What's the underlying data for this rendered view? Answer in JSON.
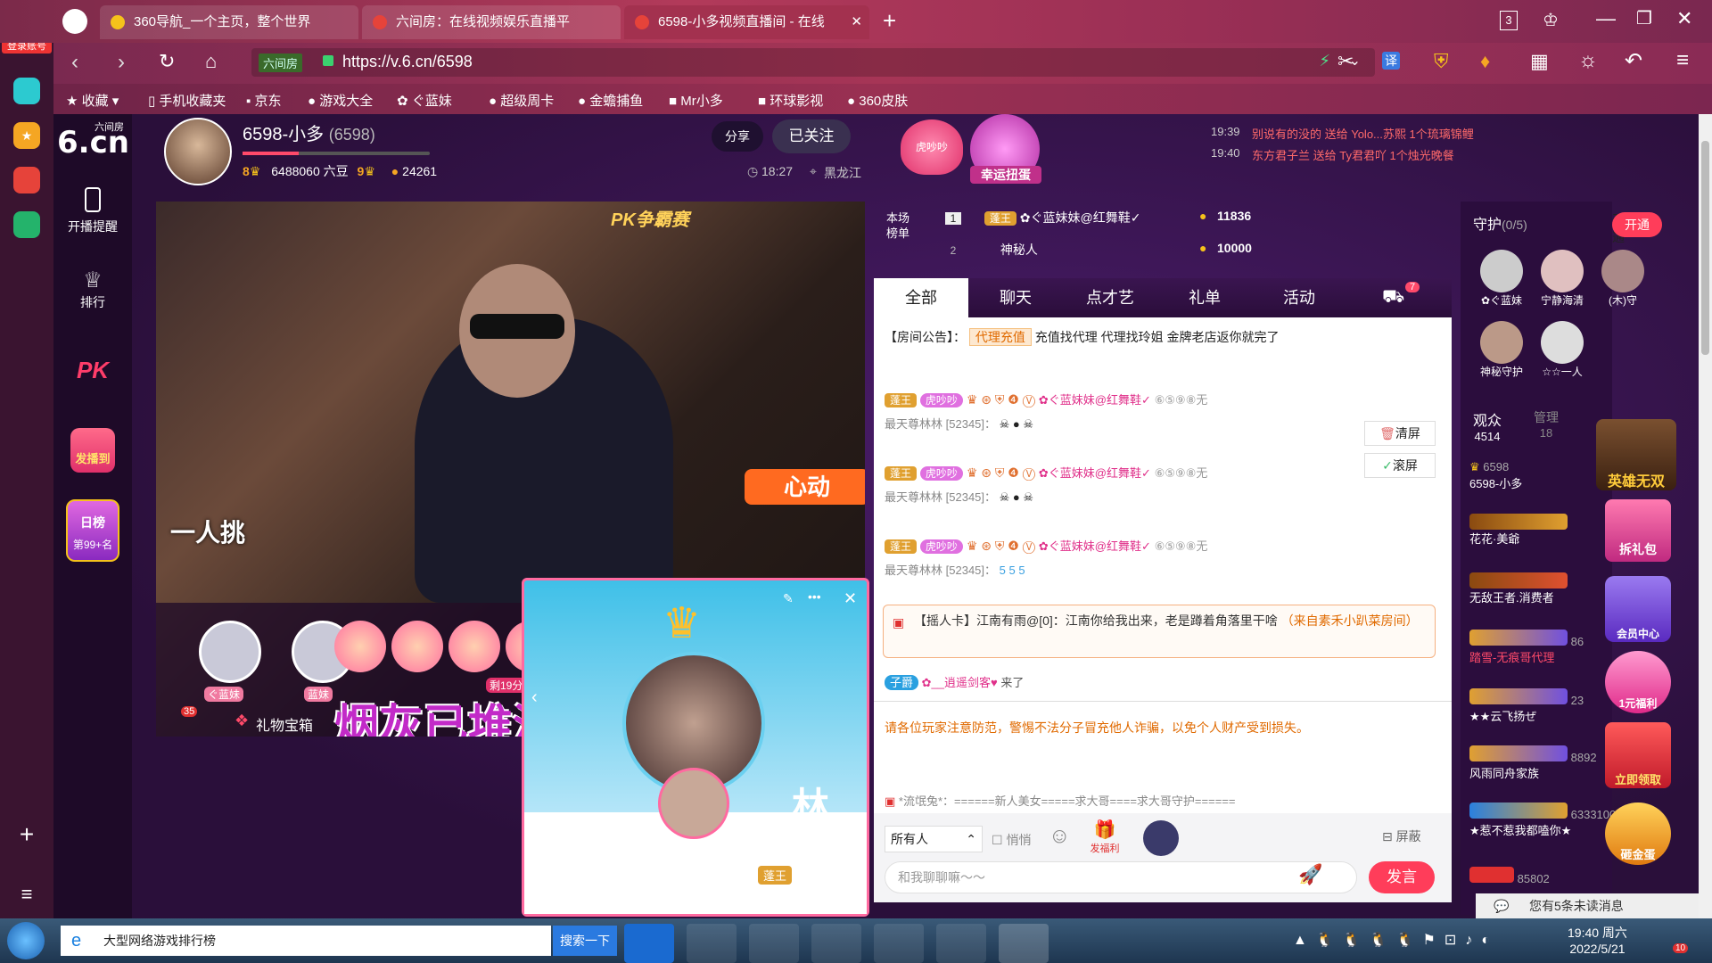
{
  "browser": {
    "left_login": "登录账号",
    "tabs": [
      {
        "title": "360导航_一个主页，整个世界"
      },
      {
        "title": "六间房：在线视频娱乐直播平"
      },
      {
        "title": "6598-小多视频直播间 - 在线"
      }
    ],
    "tab_count": "3",
    "url": "https://v.6.cn/6598",
    "url_label": "六间房",
    "bookmarks": [
      "收藏",
      "手机收藏夹",
      "京东",
      "游戏大全",
      "ぐ蓝妹",
      "超级周卡",
      "金蟾捕鱼",
      "Mr小多",
      "环球影视",
      "360皮肤"
    ]
  },
  "site": {
    "logo": "6.cn",
    "logo_sub": "六间房",
    "nav": [
      {
        "label": "开播提醒"
      },
      {
        "label": "排行"
      },
      {
        "label": "PK"
      },
      {
        "label": "发播到"
      }
    ],
    "daily": {
      "title": "日榜",
      "rank": "第99+名"
    },
    "host": {
      "name": "6598-小多",
      "id": "(6598)",
      "level_left": "8",
      "beans": "6488060 六豆",
      "level_right": "9",
      "fans": "24261",
      "time": "18:27",
      "location": "黑龙江"
    },
    "buttons": {
      "share": "分享",
      "followed": "已关注"
    },
    "badges": {
      "left": "虎吵吵",
      "lucky": "幸运扭蛋"
    },
    "ticker": [
      {
        "time": "19:39",
        "text": "别说有的没的 送给 Yolo...苏熙 1个琉璃锦鲤"
      },
      {
        "time": "19:40",
        "text": "东方君子兰 送给 Ty君君吖 1个烛光晚餐"
      }
    ],
    "video": {
      "pk_label": "PK争霸赛",
      "caption": "一人挑",
      "promo": "心动",
      "seat1": "ぐ蓝妹",
      "seat2": "蓝妹",
      "countdown": "剩19分",
      "gift_box": "礼物宝箱",
      "gift_count": "35",
      "overlay_text": "烟灰已堆满床头",
      "popup_name": "林",
      "popup_badge": "蓬王"
    },
    "rank_board": {
      "title": "本场榜单",
      "rows": [
        {
          "rank": "1",
          "badge": "蓬王",
          "name": "✿ぐ蓝妹妹@红舞鞋✓",
          "score": "11836"
        },
        {
          "rank": "2",
          "name": "神秘人",
          "score": "10000"
        }
      ]
    },
    "chat_tabs": [
      "全部",
      "聊天",
      "点才艺",
      "礼单",
      "活动"
    ],
    "chat_badge": "7",
    "notice": {
      "label": "【房间公告】：",
      "tag": "代理充值",
      "text": "充值找代理 代理找玲姐 金牌老店返你就完了"
    },
    "messages": [
      {
        "badge": "蓬王",
        "tag": "虎吵吵",
        "name": "✿ぐ蓝妹妹@红舞鞋✓",
        "suffix": "⑥⑤⑨⑧无",
        "sender": "最天尊林林",
        "uid": "[52345]："
      },
      {
        "badge": "蓬王",
        "tag": "虎吵吵",
        "name": "✿ぐ蓝妹妹@红舞鞋✓",
        "suffix": "⑥⑤⑨⑧无",
        "sender": "最天尊林林",
        "uid": "[52345]："
      },
      {
        "badge": "蓬王",
        "tag": "虎吵吵",
        "name": "✿ぐ蓝妹妹@红舞鞋✓",
        "suffix": "⑥⑤⑨⑧无",
        "sender": "最天尊林林",
        "uid": "[52345]："
      }
    ],
    "chat_tools": {
      "clear": "清屏",
      "scroll": "滚屏"
    },
    "card": {
      "text": "【摇人卡】江南有雨@[0]：江南你给我出来，老是蹲着角落里干啥",
      "source": "（来自素禾小趴菜房间）"
    },
    "join": {
      "badge": "子爵",
      "name": "✿__逍遥剑客♥",
      "action": "来了"
    },
    "warning": "请各位玩家注意防范，警惕不法分子冒充他人诈骗，以免个人财产受到损失。",
    "ad": "*流氓兔*：======新人美女=====求大哥====求大哥守护======",
    "input": {
      "target": "所有人",
      "quiet": "悄悄",
      "welfare": "发福利",
      "shield": "屏蔽",
      "placeholder": "和我聊聊嘛～～",
      "send": "发言"
    },
    "guard": {
      "title": "守护",
      "count": "(0/5)",
      "open": "开通",
      "members": [
        "✿ぐ蓝妹",
        "宁静海清",
        "(木)守",
        "神秘守护",
        "☆☆一人"
      ]
    },
    "audience": {
      "label": "观众",
      "count": "4514",
      "mgr_label": "管理",
      "mgr_count": "18"
    },
    "viewers": [
      {
        "level": "6598",
        "name": "6598-小多"
      },
      {
        "name": "花花·美爺"
      },
      {
        "name": "无敌王者.消费者"
      },
      {
        "tag": "踏雪-无痕哥代理",
        "score": "86"
      },
      {
        "name": "★★云飞扬ぜ",
        "score": "23"
      },
      {
        "name": "风雨同舟家族",
        "score": "8892"
      },
      {
        "name": "★惹不惹我都嗑你★",
        "score": "6333100"
      },
      {
        "score": "85802"
      }
    ],
    "promos": [
      "英雄无双",
      "拆礼包",
      "会员中心",
      "1元福利",
      "立即领取",
      "砸金蛋"
    ],
    "unread": "您有5条未读消息"
  },
  "taskbar": {
    "search_text": "大型网络游戏排行榜",
    "search_button": "搜索一下",
    "time": "19:40 周六",
    "date": "2022/5/21",
    "notif": "10"
  }
}
